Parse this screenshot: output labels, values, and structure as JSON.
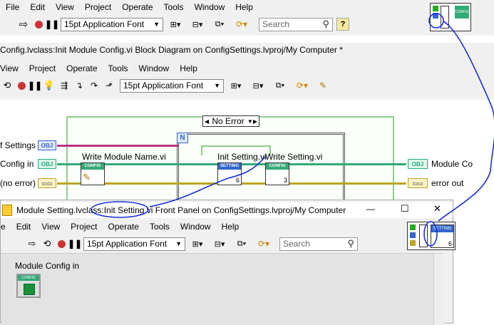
{
  "back_window": {
    "menu": [
      "File",
      "Edit",
      "View",
      "Project",
      "Operate",
      "Tools",
      "Window",
      "Help"
    ],
    "font_selector": "15pt Application Font",
    "search_placeholder": "Search",
    "help_icon": "?"
  },
  "block_diagram": {
    "title": "Config.lvclass:Init Module Config.vi Block Diagram on ConfigSettings.lvproj/My Computer *",
    "menu": [
      "View",
      "Project",
      "Operate",
      "Tools",
      "Window",
      "Help"
    ],
    "font_selector": "15pt Application Font",
    "case_selector": "No Error",
    "loop_label": "N",
    "labels": {
      "settings": "f Settings",
      "config_in": "Config in",
      "no_error": "(no error)",
      "write_module_name": "Write Module Name.vi",
      "init_setting": "Init Setting.vi",
      "write_setting": "Write Setting.vi",
      "module_config_out": "Module Co",
      "error_out": "error out"
    },
    "terminals": {
      "obj": "OBJ",
      "config": "CONFIG",
      "setting": "SETTING",
      "setting_num": "6",
      "write_setting_num": "3"
    }
  },
  "front_panel": {
    "title": "Module Setting.lvclass:Init Setting.vi Front Panel on ConfigSettings.lvproj/My Computer",
    "menu": [
      "e",
      "Edit",
      "View",
      "Project",
      "Operate",
      "Tools",
      "Window",
      "Help"
    ],
    "font_selector": "15pt Application Font",
    "search_placeholder": "Search",
    "control_label": "Module Config in",
    "control_icon_text": "CONFIG",
    "connector_text": "SETTING",
    "connector_num": "6",
    "window_controls": {
      "minimize": "—",
      "maximize": "☐",
      "close": "✕"
    }
  },
  "annotation_color": "#1a2fd6"
}
